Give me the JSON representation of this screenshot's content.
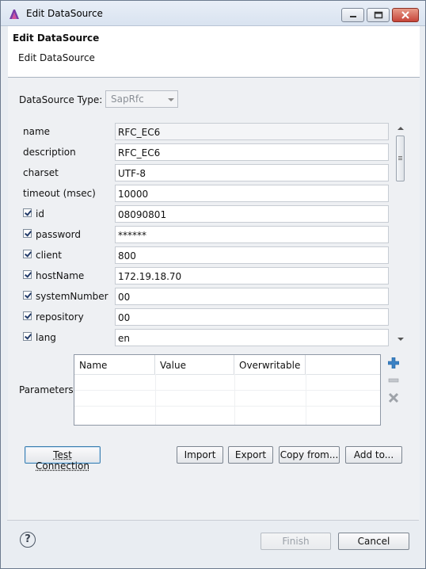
{
  "window": {
    "title": "Edit DataSource"
  },
  "header": {
    "title": "Edit DataSource",
    "subtitle": "Edit DataSource"
  },
  "datasource_type": {
    "label": "DataSource Type:",
    "value": "SapRfc"
  },
  "properties": [
    {
      "name": "name",
      "value": "RFC_EC6",
      "checkbox": false,
      "readonly": true
    },
    {
      "name": "description",
      "value": "RFC_EC6",
      "checkbox": false
    },
    {
      "name": "charset",
      "value": "UTF-8",
      "checkbox": false
    },
    {
      "name": "timeout (msec)",
      "value": "10000",
      "checkbox": false
    },
    {
      "name": "id",
      "value": "08090801",
      "checkbox": true,
      "checked": true
    },
    {
      "name": "password",
      "value": "******",
      "checkbox": true,
      "checked": true
    },
    {
      "name": "client",
      "value": "800",
      "checkbox": true,
      "checked": true
    },
    {
      "name": "hostName",
      "value": "172.19.18.70",
      "checkbox": true,
      "checked": true
    },
    {
      "name": "systemNumber",
      "value": "00",
      "checkbox": true,
      "checked": true
    },
    {
      "name": "repository",
      "value": "00",
      "checkbox": true,
      "checked": true
    },
    {
      "name": "lang",
      "value": "en",
      "checkbox": true,
      "checked": true
    }
  ],
  "parameters": {
    "label": "Parameters",
    "columns": [
      "Name",
      "Value",
      "Overwritable"
    ],
    "icons": [
      "add-icon",
      "remove-icon",
      "delete-icon"
    ]
  },
  "buttons": {
    "test_connection": "Test Connection",
    "import": "Import",
    "export": "Export",
    "copy_from": "Copy from...",
    "add_to": "Add to...",
    "finish": "Finish",
    "cancel": "Cancel"
  },
  "colors": {
    "accent": "#3c7fb1",
    "close": "#c6453a"
  }
}
